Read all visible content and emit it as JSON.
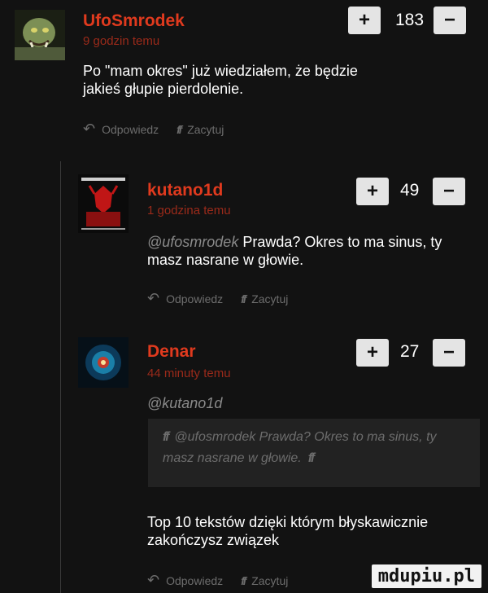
{
  "comments": [
    {
      "username": "UfoSmrodek",
      "time": "9 godzin temu",
      "score": "183",
      "plus": "+",
      "minus": "−",
      "text": "Po \"mam okres\" już wiedziałem, że będzie jakieś głupie pierdolenie.",
      "reply_label": "Odpowiedz",
      "quote_label": "Zacytuj",
      "avatar_icon": "orc-warrior-avatar"
    },
    {
      "username": "kutano1d",
      "time": "1 godzina temu",
      "score": "49",
      "plus": "+",
      "minus": "−",
      "mention": "@ufosmrodek",
      "text": "Prawda? Okres to ma sinus, ty masz nasrane w głowie.",
      "reply_label": "Odpowiedz",
      "quote_label": "Zacytuj",
      "avatar_icon": "red-demon-poster-avatar"
    },
    {
      "username": "Denar",
      "time": "44 minuty temu",
      "score": "27",
      "plus": "+",
      "minus": "−",
      "mention": "@kutano1d",
      "quote_text": "@ufosmrodek Prawda? Okres to ma sinus, ty masz nasrane w głowie.",
      "text": "Top 10 tekstów dzięki którym błyskawicznie zakończysz związek",
      "reply_label": "Odpowiedz",
      "quote_label": "Zacytuj",
      "avatar_icon": "galaxy-eye-avatar"
    }
  ],
  "watermark": "mdupiu.pl",
  "colors": {
    "username": "#e03a1e",
    "background": "#121212",
    "muted": "#6d6d6d"
  }
}
